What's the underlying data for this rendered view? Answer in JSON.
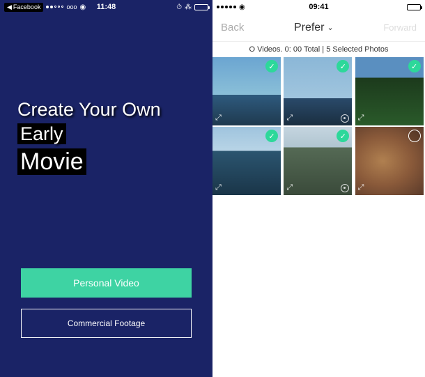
{
  "left": {
    "status": {
      "back_app": "Facebook",
      "carrier": "ooo",
      "time": "11:48",
      "icons": {
        "alarm": "⏰",
        "bluetooth": "✱",
        "battery": true
      }
    },
    "hero": {
      "line1": "Create Your Own",
      "line2": "Early",
      "line3": "Movie"
    },
    "buttons": {
      "primary": "Personal Video",
      "secondary": "Commercial Footage"
    }
  },
  "right": {
    "status": {
      "time": "09:41",
      "icons": {
        "battery": true
      }
    },
    "nav": {
      "back": "Back",
      "title": "Prefer",
      "forward": "Forward"
    },
    "info": "O Videos. 0: 00 Total | 5 Selected Photos",
    "thumbs": [
      {
        "selected": true,
        "live": false,
        "cls": "sky1"
      },
      {
        "selected": true,
        "live": true,
        "cls": "sky2"
      },
      {
        "selected": true,
        "live": false,
        "cls": "sky3"
      },
      {
        "selected": true,
        "live": false,
        "cls": "sky4"
      },
      {
        "selected": true,
        "live": true,
        "cls": "sky5"
      },
      {
        "selected": false,
        "live": false,
        "cls": "cat"
      }
    ]
  }
}
